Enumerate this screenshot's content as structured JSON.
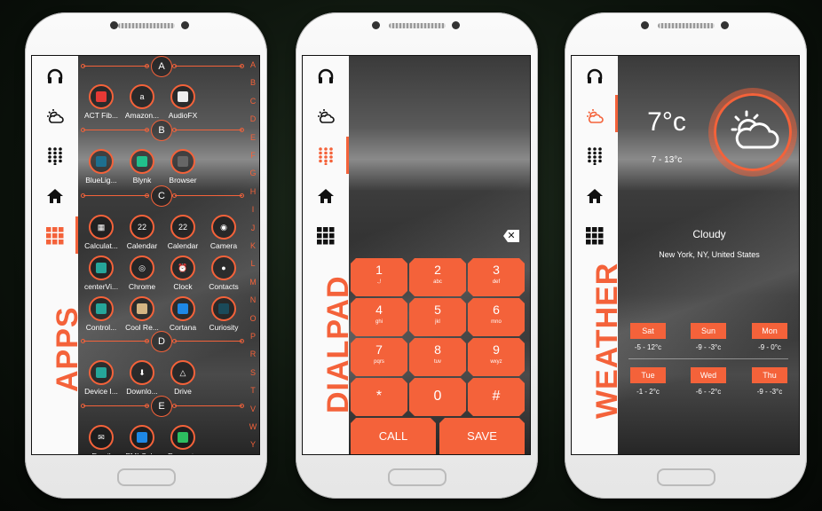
{
  "colors": {
    "accent": "#f4623a",
    "sidebar": "#fafafa"
  },
  "sidebar_icons": [
    "headphones-icon",
    "weather-icon",
    "dialpad-icon",
    "home-icon",
    "apps-grid-icon"
  ],
  "apps_screen": {
    "label": "APPS",
    "sections": [
      {
        "letter": "A",
        "apps": [
          {
            "name": "ACT Fib...",
            "color": "#e53935"
          },
          {
            "name": "Amazon...",
            "glyph": "a"
          },
          {
            "name": "AudioFX",
            "color": "#eee"
          }
        ]
      },
      {
        "letter": "B",
        "apps": [
          {
            "name": "BlueLig...",
            "color": "#1e6f8f"
          },
          {
            "name": "Blynk",
            "color": "#21c08b"
          },
          {
            "name": "Browser",
            "color": "#666"
          }
        ]
      },
      {
        "letter": "C",
        "apps": [
          {
            "name": "Calculat...",
            "glyph": "▦"
          },
          {
            "name": "Calendar",
            "glyph": "22"
          },
          {
            "name": "Calendar",
            "glyph": "22"
          },
          {
            "name": "Camera",
            "glyph": "◉"
          },
          {
            "name": "centerVi...",
            "color": "#26a69a"
          },
          {
            "name": "Chrome",
            "glyph": "◎"
          },
          {
            "name": "Clock",
            "glyph": "⏰"
          },
          {
            "name": "Contacts",
            "glyph": "●"
          },
          {
            "name": "Control...",
            "color": "#26a69a"
          },
          {
            "name": "Cool Re...",
            "color": "#d4b483"
          },
          {
            "name": "Cortana",
            "color": "#1e88e5"
          },
          {
            "name": "Curiosity",
            "color": "#1a4a5a"
          }
        ]
      },
      {
        "letter": "D",
        "apps": [
          {
            "name": "Device I...",
            "color": "#26a69a"
          },
          {
            "name": "Downlo...",
            "glyph": "⬇"
          },
          {
            "name": "Drive",
            "glyph": "△"
          }
        ]
      },
      {
        "letter": "E",
        "apps": [
          {
            "name": "Email",
            "glyph": "✉"
          },
          {
            "name": "EMI Cal...",
            "color": "#1e88e5"
          },
          {
            "name": "Evernote",
            "color": "#2dbe60"
          }
        ]
      }
    ],
    "alphabet": [
      "A",
      "B",
      "C",
      "D",
      "E",
      "F",
      "G",
      "H",
      "I",
      "J",
      "K",
      "L",
      "M",
      "N",
      "O",
      "P",
      "R",
      "S",
      "T",
      "V",
      "W",
      "Y"
    ]
  },
  "dialpad_screen": {
    "label": "DIALPAD",
    "keys": [
      {
        "d": "1",
        "s": ".,!"
      },
      {
        "d": "2",
        "s": "abc"
      },
      {
        "d": "3",
        "s": "def"
      },
      {
        "d": "4",
        "s": "ghi"
      },
      {
        "d": "5",
        "s": "jkl"
      },
      {
        "d": "6",
        "s": "mno"
      },
      {
        "d": "7",
        "s": "pqrs"
      },
      {
        "d": "8",
        "s": "tuv"
      },
      {
        "d": "9",
        "s": "wxyz"
      },
      {
        "d": "*",
        "s": ""
      },
      {
        "d": "0",
        "s": ""
      },
      {
        "d": "#",
        "s": ""
      }
    ],
    "call": "CALL",
    "save": "SAVE"
  },
  "weather_screen": {
    "label": "WEATHER",
    "temp": "7°c",
    "range": "7 - 13°c",
    "condition": "Cloudy",
    "location": "New York,  NY, United States",
    "forecast": [
      {
        "day": "Sat",
        "t": "-5 - 12°c"
      },
      {
        "day": "Sun",
        "t": "-9 - -3°c"
      },
      {
        "day": "Mon",
        "t": "-9 - 0°c"
      },
      {
        "day": "Tue",
        "t": "-1 - 2°c"
      },
      {
        "day": "Wed",
        "t": "-6 - -2°c"
      },
      {
        "day": "Thu",
        "t": "-9 - -3°c"
      }
    ]
  }
}
